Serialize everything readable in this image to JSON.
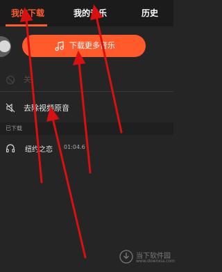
{
  "tabs": [
    {
      "label": "我的下载",
      "active": true
    },
    {
      "label": "我的音乐",
      "active": false
    },
    {
      "label": "历史",
      "active": false
    }
  ],
  "download_more": {
    "label": "下载更多音乐",
    "icon": "music-note-icon"
  },
  "faint_row": {
    "text": "关"
  },
  "remove_original": {
    "label": "去除视频原音",
    "icon": "mute-icon"
  },
  "section": {
    "title": "已下载"
  },
  "songs": [
    {
      "title": "纽约之恋",
      "duration": "01:04.6",
      "icon": "headphones-icon"
    }
  ],
  "watermark": {
    "text": "当下软件园",
    "sub": "www.downxia.com"
  },
  "colors": {
    "accent": "#ff5a2c",
    "background": "#252525",
    "arrow": "#d81010"
  }
}
